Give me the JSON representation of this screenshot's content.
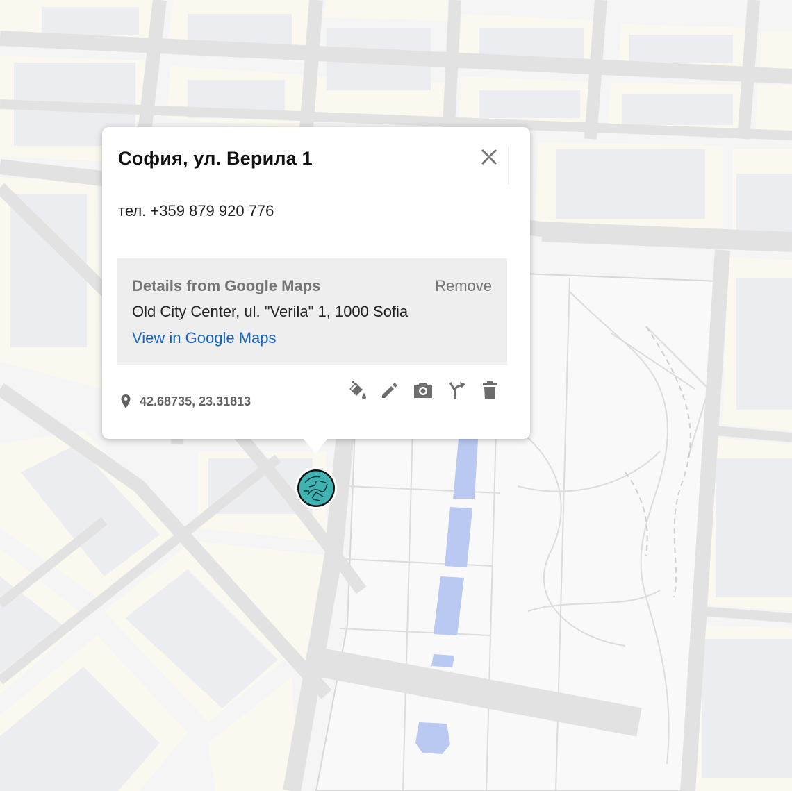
{
  "map": {
    "colors": {
      "background": "#f4f4f4",
      "road": "#e3e3e3",
      "block": "#fbfaf3",
      "building": "#e9eaee",
      "park": "#f8f8f8",
      "water": "#b9c9f2"
    }
  },
  "info_window": {
    "title": "София, ул. Верила 1",
    "description": "тел. +359 879 920 776",
    "google_maps_details": {
      "heading": "Details from Google Maps",
      "remove_label": "Remove",
      "address": "Old City Center, ul. \"Verila\" 1, 1000 Sofia",
      "link_label": "View in Google Maps"
    },
    "coordinates": "42.68735, 23.31813",
    "tools": [
      {
        "icon": "paint-bucket-icon",
        "label": "Style"
      },
      {
        "icon": "pencil-icon",
        "label": "Edit"
      },
      {
        "icon": "camera-icon",
        "label": "Add image"
      },
      {
        "icon": "directions-icon",
        "label": "Directions"
      },
      {
        "icon": "trash-icon",
        "label": "Delete"
      }
    ]
  },
  "marker": {
    "icon": "place-marker-icon",
    "color": "#3fb2b2"
  }
}
